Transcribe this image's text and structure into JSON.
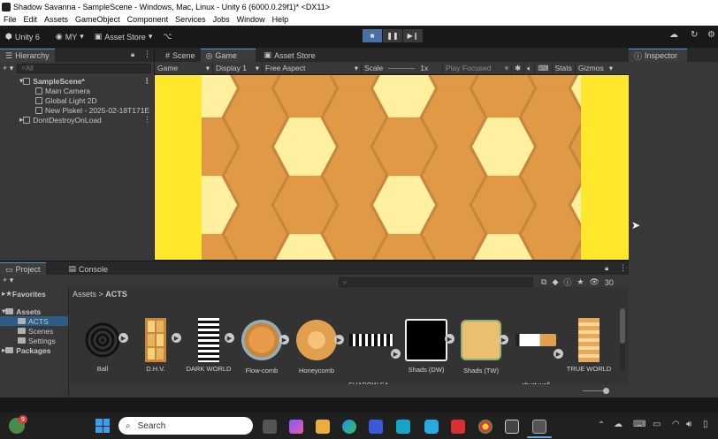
{
  "window": {
    "title": "Shadow Savanna - SampleScene - Windows, Mac, Linux - Unity 6 (6000.0.29f1)* <DX11>"
  },
  "menu": [
    "File",
    "Edit",
    "Assets",
    "GameObject",
    "Component",
    "Services",
    "Jobs",
    "Window",
    "Help"
  ],
  "toolbar": {
    "unity_label": "Unity 6",
    "account_label": "MY",
    "asset_store_label": "Asset Store"
  },
  "hierarchy": {
    "tab": "Hierarchy",
    "search_placeholder": "All",
    "items": [
      {
        "label": "SampleScene*",
        "depth": 0
      },
      {
        "label": "Main Camera",
        "depth": 1
      },
      {
        "label": "Global Light 2D",
        "depth": 1
      },
      {
        "label": "New Piskel - 2025-02-18T171E",
        "depth": 1
      },
      {
        "label": "DontDestroyOnLoad",
        "depth": 0
      }
    ]
  },
  "center_tabs": [
    "Scene",
    "Game",
    "Asset Store"
  ],
  "game_toolbar": {
    "mode": "Game",
    "display": "Display 1",
    "aspect": "Free Aspect",
    "scale_label": "Scale",
    "scale_value": "1x",
    "play_focused": "Play Focused",
    "stats": "Stats",
    "gizmos": "Gizmos"
  },
  "inspector": {
    "tab": "Inspector"
  },
  "project": {
    "tabs": [
      "Project",
      "Console"
    ],
    "favorites_label": "Favorites",
    "assets_label": "Assets",
    "folders": [
      "ACTS",
      "Scenes",
      "Settings"
    ],
    "packages_label": "Packages",
    "breadcrumb_root": "Assets",
    "breadcrumb_current": "ACTS",
    "count": "30",
    "assets": [
      "Ball",
      "D.H.V.",
      "DARK WORLD",
      "Flow-comb",
      "Honeycomb",
      "SHADOW SA...",
      "Shads (DW)",
      "Shads (TW)",
      "shurt wall",
      "TRUE WORLD"
    ]
  },
  "taskbar": {
    "search_label": "Search",
    "badge": "9"
  },
  "colors": {
    "accent": "#4a90e2",
    "letterbox": "#ffe82b",
    "honey_bg": "#c8863c",
    "honey_light": "#fff0a0"
  }
}
